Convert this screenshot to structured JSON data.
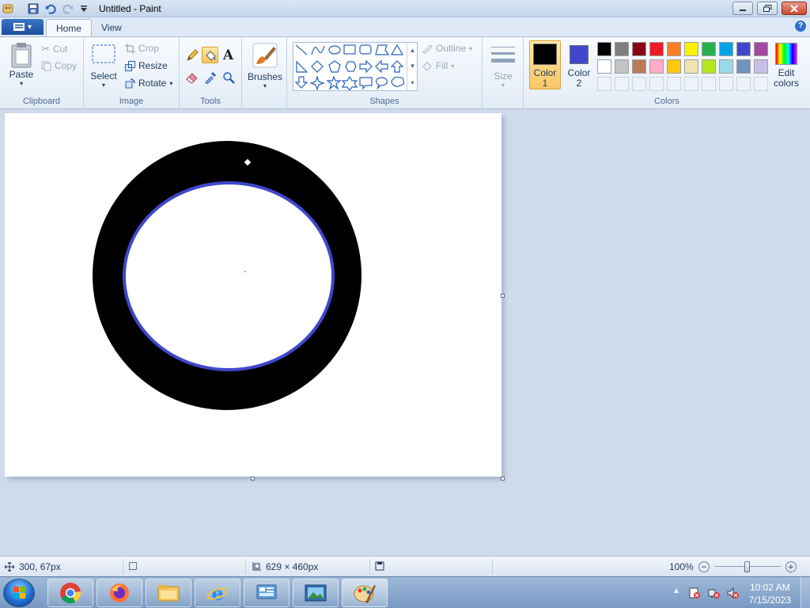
{
  "window": {
    "title": "Untitled - Paint",
    "minimize_icon": "minimize-icon",
    "maximize_icon": "restore-icon",
    "close_icon": "close-icon"
  },
  "quick_access": [
    "save-icon",
    "undo-icon",
    "redo-icon",
    "customize-dropdown-icon"
  ],
  "tabs": [
    {
      "label": "Home",
      "active": true
    },
    {
      "label": "View",
      "active": false
    }
  ],
  "ribbon": {
    "clipboard": {
      "group_label": "Clipboard",
      "paste": "Paste",
      "cut": "Cut",
      "copy": "Copy"
    },
    "image": {
      "group_label": "Image",
      "select": "Select",
      "crop": "Crop",
      "resize": "Resize",
      "rotate": "Rotate"
    },
    "tools": {
      "group_label": "Tools",
      "items": [
        "pencil-icon",
        "fill-bucket-icon",
        "text-icon",
        "eraser-icon",
        "color-picker-icon",
        "magnifier-icon"
      ],
      "active": "fill-bucket-icon"
    },
    "brushes": {
      "label": "Brushes"
    },
    "shapes": {
      "group_label": "Shapes",
      "items": [
        "line",
        "curve",
        "oval",
        "rectangle",
        "rounded-rectangle",
        "polygon",
        "triangle",
        "right-triangle",
        "diamond",
        "pentagon",
        "hexagon",
        "right-arrow",
        "left-arrow",
        "up-arrow",
        "down-arrow",
        "four-point-star",
        "five-point-star",
        "six-point-star",
        "rounded-callout",
        "oval-callout",
        "cloud-callout"
      ],
      "outline": "Outline",
      "fill": "Fill"
    },
    "size": {
      "label": "Size"
    },
    "colors": {
      "group_label": "Colors",
      "color1_line1": "Color",
      "color1_line2": "1",
      "color1_value": "#000000",
      "color2_line1": "Color",
      "color2_line2": "2",
      "color2_value": "#3f48cc",
      "edit_line1": "Edit",
      "edit_line2": "colors",
      "palette_row1": [
        "#000000",
        "#7f7f7f",
        "#880015",
        "#ed1c24",
        "#ff7f27",
        "#fff200",
        "#22b14c",
        "#00a2e8",
        "#3f48cc",
        "#a349a4"
      ],
      "palette_row2": [
        "#ffffff",
        "#c3c3c3",
        "#b97a57",
        "#ffaec9",
        "#ffc90e",
        "#efe4b0",
        "#b5e61d",
        "#99d9ea",
        "#7092be",
        "#c8bfe7"
      ]
    }
  },
  "canvas": {
    "background": "#ffffff",
    "ring_color": "#000000",
    "inner_outline_color": "#3f48cc"
  },
  "status": {
    "cursor_pos": "300, 67px",
    "canvas_size": "629 × 460px",
    "zoom": "100%",
    "zoom_slider_fraction": 0.5
  },
  "taskbar": {
    "apps": [
      "chrome-icon",
      "firefox-icon",
      "file-explorer-icon",
      "internet-explorer-icon",
      "control-panel-icon",
      "photo-viewer-icon",
      "paint-icon"
    ],
    "active_app": "paint-icon",
    "time": "10:02 AM",
    "date": "7/15/2023"
  }
}
